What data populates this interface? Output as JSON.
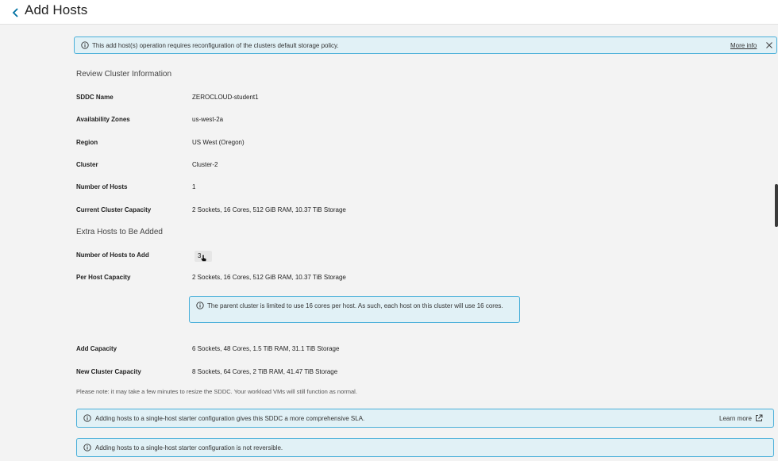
{
  "header": {
    "title": "Add Hosts"
  },
  "banner_top": {
    "message": "This add host(s) operation requires reconfiguration of the clusters default storage policy.",
    "link": "More info"
  },
  "review": {
    "title": "Review Cluster Information",
    "rows": [
      {
        "label": "SDDC Name",
        "value": "ZEROCLOUD-student1"
      },
      {
        "label": "Availability Zones",
        "value": "us-west-2a"
      },
      {
        "label": "Region",
        "value": "US West (Oregon)"
      },
      {
        "label": "Cluster",
        "value": "Cluster-2"
      },
      {
        "label": "Number of Hosts",
        "value": "1"
      },
      {
        "label": "Current Cluster Capacity",
        "value": "2 Sockets, 16 Cores, 512 GiB RAM, 10.37 TiB Storage"
      }
    ]
  },
  "extra": {
    "title": "Extra Hosts to Be Added",
    "hosts_to_add_label": "Number of Hosts to Add",
    "hosts_to_add_value": "3",
    "per_host_label": "Per Host Capacity",
    "per_host_value": "2 Sockets, 16 Cores, 512 GiB RAM, 10.37 TiB Storage",
    "cores_notice": "The parent cluster is limited to use 16 cores per host. As such, each host on this cluster will use 16 cores.",
    "add_capacity_label": "Add Capacity",
    "add_capacity_value": "6 Sockets, 48 Cores, 1.5 TiB RAM, 31.1 TiB Storage",
    "new_capacity_label": "New Cluster Capacity",
    "new_capacity_value": "8 Sockets, 64 Cores, 2 TiB RAM, 41.47 TiB Storage"
  },
  "note": "Please note: it may take a few minutes to resize the SDDC. Your workload VMs will still function as normal.",
  "banner_sla": {
    "message": "Adding hosts to a single-host starter configuration gives this SDDC a more comprehensive SLA.",
    "link": "Learn more"
  },
  "banner_irreversible": {
    "message": "Adding hosts to a single-host starter configuration is not reversible."
  },
  "colors": {
    "info_border": "#49afd9",
    "info_bg": "#e1f1f6",
    "accent": "#0072a3"
  },
  "icons": [
    "chevron-left-icon",
    "info-circle-icon",
    "close-icon",
    "external-link-icon",
    "pointer-cursor-icon"
  ]
}
